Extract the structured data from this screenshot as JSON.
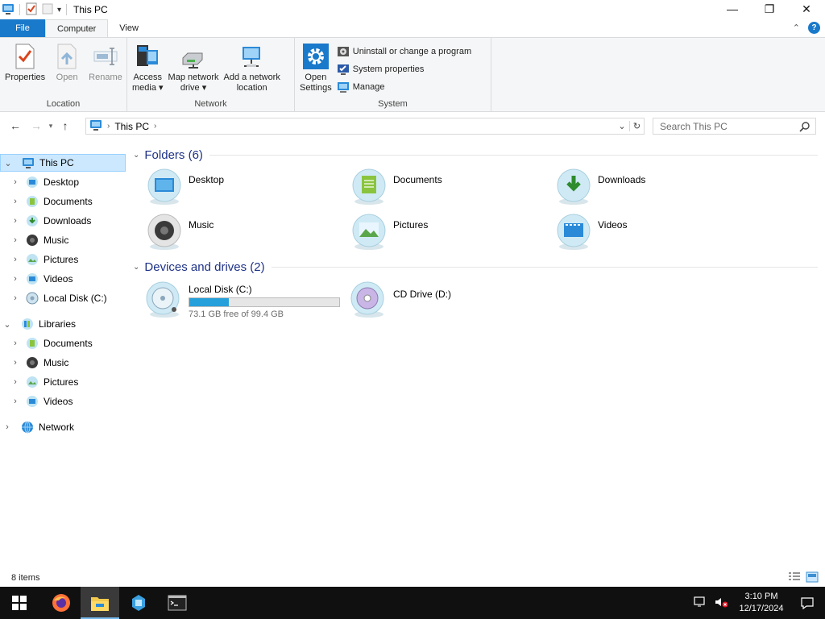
{
  "window": {
    "title": "This PC",
    "controls": {
      "minimize": "—",
      "restore": "❐",
      "close": "✕"
    }
  },
  "ribbon_tabs": {
    "file": "File",
    "computer": "Computer",
    "view": "View"
  },
  "ribbon": {
    "location": {
      "label": "Location",
      "properties": "Properties",
      "open": "Open",
      "rename": "Rename"
    },
    "network": {
      "label": "Network",
      "access_media": "Access media",
      "access_media_line1": "Access",
      "access_media_line2": "media ▾",
      "map_drive_line1": "Map network",
      "map_drive_line2": "drive ▾",
      "add_location_line1": "Add a network",
      "add_location_line2": "location"
    },
    "system": {
      "label": "System",
      "open_settings_line1": "Open",
      "open_settings_line2": "Settings",
      "uninstall": "Uninstall or change a program",
      "system_properties": "System properties",
      "manage": "Manage"
    }
  },
  "address_bar": {
    "crumb": "This PC",
    "search_placeholder": "Search This PC"
  },
  "nav_pane": {
    "this_pc": "This PC",
    "this_pc_children": [
      "Desktop",
      "Documents",
      "Downloads",
      "Music",
      "Pictures",
      "Videos",
      "Local Disk (C:)"
    ],
    "libraries": "Libraries",
    "library_children": [
      "Documents",
      "Music",
      "Pictures",
      "Videos"
    ],
    "network": "Network"
  },
  "content": {
    "folders_header": "Folders (6)",
    "folders": [
      "Desktop",
      "Documents",
      "Downloads",
      "Music",
      "Pictures",
      "Videos"
    ],
    "devices_header": "Devices and drives (2)",
    "drives": {
      "c_name": "Local Disk (C:)",
      "c_free": "73.1 GB free of 99.4 GB",
      "c_used_fraction": 0.265,
      "d_name": "CD Drive (D:)"
    }
  },
  "status": {
    "items": "8 items"
  },
  "taskbar": {
    "time": "3:10 PM",
    "date": "12/17/2024"
  },
  "colors": {
    "accent": "#1979ca",
    "selection": "#cce8ff",
    "drive_bar": "#26a0da",
    "header_text": "#1e3287"
  }
}
